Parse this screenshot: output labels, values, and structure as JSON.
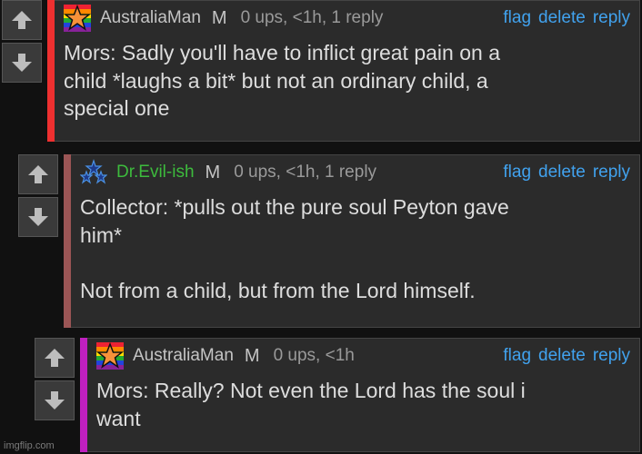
{
  "comments": [
    {
      "username": "AustraliaMan",
      "badge": "M",
      "meta": "0 ups, <1h, 1 reply",
      "actions": {
        "flag": "flag",
        "delete": "delete",
        "reply": "reply"
      },
      "text": "Mors: Sadly you'll have to inflict great pain on a\nchild *laughs a bit* but not an ordinary child, a\nspecial one",
      "bar_color": "#ee3030",
      "username_color": "#c4c4c4"
    },
    {
      "username": "Dr.Evil-ish",
      "badge": "M",
      "meta": "0 ups, <1h, 1 reply",
      "actions": {
        "flag": "flag",
        "delete": "delete",
        "reply": "reply"
      },
      "text": "Collector: *pulls out the pure soul Peyton gave\nhim*\n\nNot from a child, but from the Lord himself.",
      "bar_color": "#9b5555",
      "username_color": "#3dbb3d"
    },
    {
      "username": "AustraliaMan",
      "badge": "M",
      "meta": "0 ups, <1h",
      "actions": {
        "flag": "flag",
        "delete": "delete",
        "reply": "reply"
      },
      "text": "Mors: Really? Not even the Lord has the soul i\nwant",
      "bar_color": "#c020c0",
      "username_color": "#c4c4c4"
    }
  ],
  "icons": {
    "upvote": "arrow-up-icon",
    "downvote": "arrow-down-icon",
    "avatar1": "rainbow-star-avatar",
    "avatar2": "blue-stars-avatar"
  },
  "colors": {
    "link": "#41a2ee",
    "background": "#111111",
    "panel": "#2b2b2b"
  },
  "watermark": "imgflip.com"
}
